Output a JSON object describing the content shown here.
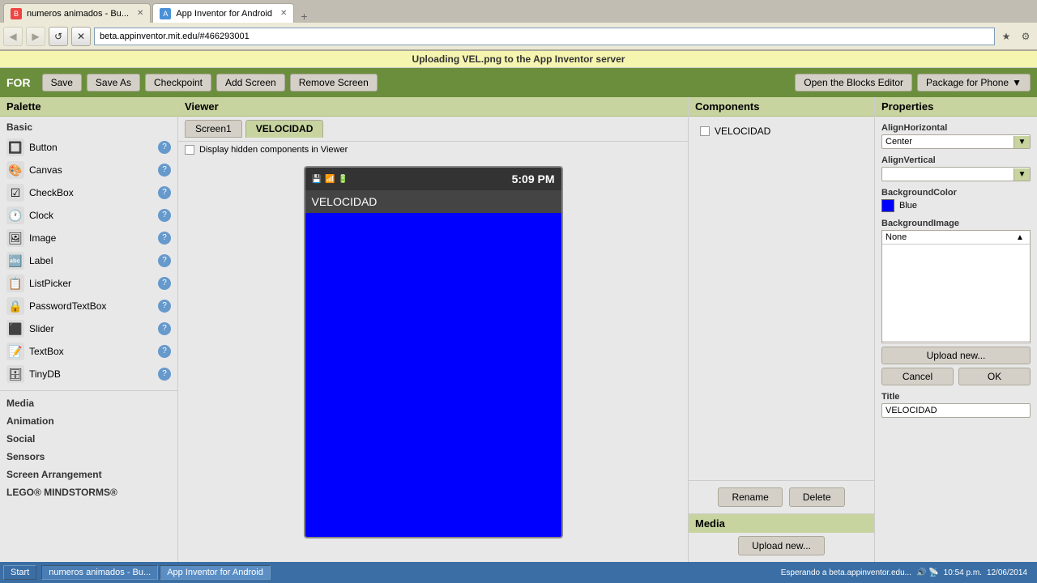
{
  "browser": {
    "tabs": [
      {
        "id": "tab1",
        "label": "numeros animados - Bu...",
        "favicon_color": "#e44",
        "active": false
      },
      {
        "id": "tab2",
        "label": "App Inventor for Android",
        "favicon_color": "#4a90d9",
        "active": true
      }
    ],
    "address": "beta.appinventor.mit.edu/#466293001"
  },
  "status_bar": {
    "message": "Uploading VEL.png to the App Inventor server"
  },
  "toolbar": {
    "logo": "FOR",
    "save_label": "Save",
    "save_as_label": "Save As",
    "checkpoint_label": "Checkpoint",
    "add_screen_label": "Add Screen",
    "remove_screen_label": "Remove Screen",
    "blocks_editor_label": "Open the Blocks Editor",
    "package_label": "Package for Phone"
  },
  "palette": {
    "header": "Palette",
    "sections": [
      {
        "label": "Basic",
        "items": [
          {
            "name": "Button",
            "icon": "🔲"
          },
          {
            "name": "Canvas",
            "icon": "🖼"
          },
          {
            "name": "CheckBox",
            "icon": "☑"
          },
          {
            "name": "Clock",
            "icon": "🕐"
          },
          {
            "name": "Image",
            "icon": "🖼"
          },
          {
            "name": "Label",
            "icon": "🔤"
          },
          {
            "name": "ListPicker",
            "icon": "📋"
          },
          {
            "name": "PasswordTextBox",
            "icon": "🔒"
          },
          {
            "name": "Slider",
            "icon": "⬛"
          },
          {
            "name": "TextBox",
            "icon": "📝"
          },
          {
            "name": "TinyDB",
            "icon": "🗄"
          }
        ]
      },
      {
        "label": "Media",
        "items": []
      },
      {
        "label": "Animation",
        "items": []
      },
      {
        "label": "Social",
        "items": []
      },
      {
        "label": "Sensors",
        "items": []
      },
      {
        "label": "Screen Arrangement",
        "items": []
      },
      {
        "label": "LEGO® MINDSTORMS®",
        "items": []
      }
    ]
  },
  "viewer": {
    "header": "Viewer",
    "tabs": [
      "Screen1",
      "VELOCIDAD"
    ],
    "active_tab": "VELOCIDAD",
    "checkbox_label": "Display hidden components in Viewer",
    "phone": {
      "time": "5:09 PM",
      "title": "VELOCIDAD",
      "screen_color": "#0000ff"
    }
  },
  "components": {
    "header": "Components",
    "items": [
      {
        "label": "VELOCIDAD",
        "checked": false
      }
    ],
    "rename_label": "Rename",
    "delete_label": "Delete",
    "media_header": "Media",
    "upload_new_label": "Upload new..."
  },
  "properties": {
    "header": "Properties",
    "align_horizontal_label": "AlignHorizontal",
    "align_horizontal_value": "Center",
    "align_vertical_label": "AlignVertical",
    "align_vertical_value": "",
    "background_color_label": "BackgroundColor",
    "background_color_name": "Blue",
    "background_color_hex": "#0000ff",
    "background_image_label": "BackgroundImage",
    "background_image_value": "None",
    "upload_new_label": "Upload new...",
    "cancel_label": "Cancel",
    "ok_label": "OK",
    "title_label": "Title",
    "title_value": "VELOCIDAD"
  },
  "taskbar": {
    "status": "Esperando a beta.appinventor.edu...",
    "time": "10:54 p.m.",
    "date": "12/06/2014",
    "items": [
      {
        "label": "numeros animados - Bu...",
        "active": false
      },
      {
        "label": "App Inventor for Android",
        "active": true
      }
    ]
  }
}
